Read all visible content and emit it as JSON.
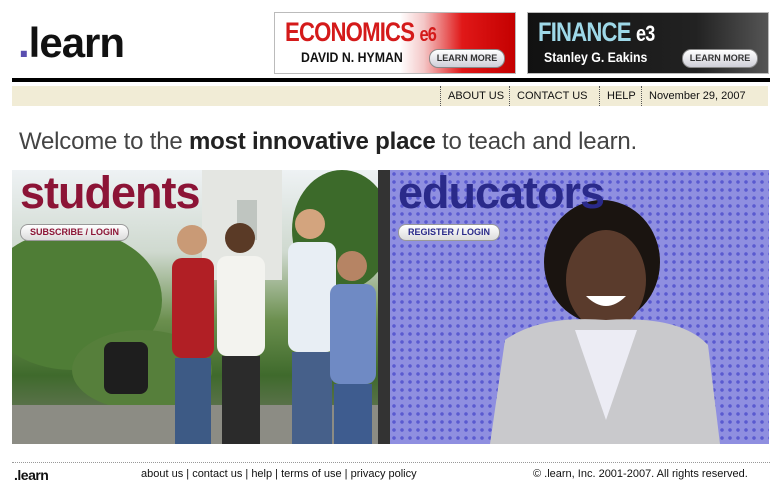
{
  "logo": {
    "dot": ".",
    "text": "learn"
  },
  "ads": [
    {
      "title": "ECONOMICS",
      "edition": "e6",
      "author": "DAVID N. HYMAN",
      "cta": "LEARN MORE"
    },
    {
      "title": "FINANCE",
      "edition": "e3",
      "author": "Stanley G. Eakins",
      "cta": "LEARN MORE"
    }
  ],
  "nav": {
    "about": "ABOUT US",
    "contact": "CONTACT US",
    "help": "HELP",
    "date": "November 29, 2007"
  },
  "welcome": {
    "part1": "Welcome to the ",
    "bold": "most innovative place",
    "part2": " to teach and learn."
  },
  "students": {
    "heading": "students",
    "action": "SUBSCRIBE / LOGIN"
  },
  "educators": {
    "heading": "educators",
    "action": "REGISTER / LOGIN"
  },
  "footer": {
    "logo": ".learn",
    "links": [
      "about us",
      "contact us",
      "help",
      "terms of use",
      "privacy policy"
    ],
    "separator": " | ",
    "copyright": "© .learn, Inc. 2001-2007.  All rights reserved."
  }
}
